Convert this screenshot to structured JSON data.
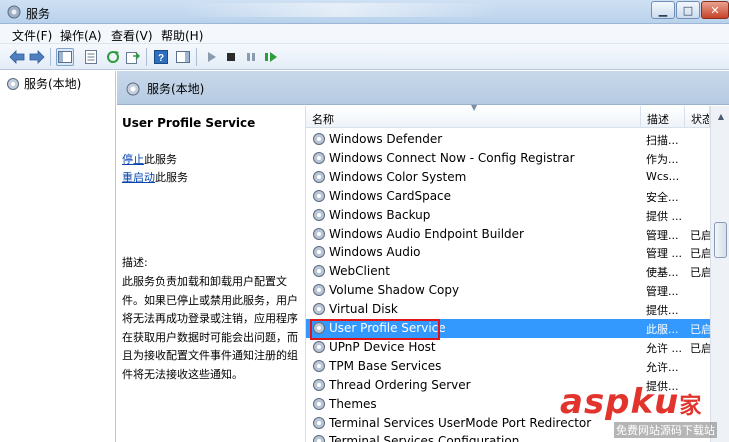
{
  "window": {
    "title": "服务"
  },
  "menu": [
    {
      "label": "文件(F)"
    },
    {
      "label": "操作(A)"
    },
    {
      "label": "查看(V)"
    },
    {
      "label": "帮助(H)"
    }
  ],
  "tree": {
    "root_label": "服务(本地)"
  },
  "header": {
    "title": "服务(本地)"
  },
  "details": {
    "service_name": "User Profile Service",
    "stop_link": "停止",
    "stop_suffix": "此服务",
    "restart_link": "重启动",
    "restart_suffix": "此服务",
    "description_label": "描述:",
    "description_text": "此服务负责加载和卸载用户配置文件。如果已停止或禁用此服务，用户将无法再成功登录或注销，应用程序在获取用户数据时可能会出问题，而且为接收配置文件事件通知注册的组件将无法接收这些通知。"
  },
  "columns": {
    "name": "名称",
    "description": "描述",
    "status": "状态"
  },
  "rows": [
    {
      "name": "Windows Defender",
      "desc": "扫描...",
      "status": ""
    },
    {
      "name": "Windows Connect Now - Config Registrar",
      "desc": "作为...",
      "status": ""
    },
    {
      "name": "Windows Color System",
      "desc": "Wcs...",
      "status": ""
    },
    {
      "name": "Windows CardSpace",
      "desc": "安全...",
      "status": ""
    },
    {
      "name": "Windows Backup",
      "desc": "提供 ...",
      "status": ""
    },
    {
      "name": "Windows Audio Endpoint Builder",
      "desc": "管理...",
      "status": "已启"
    },
    {
      "name": "Windows Audio",
      "desc": "管理 ...",
      "status": "已启"
    },
    {
      "name": "WebClient",
      "desc": "使基...",
      "status": "已启"
    },
    {
      "name": "Volume Shadow Copy",
      "desc": "管理...",
      "status": ""
    },
    {
      "name": "Virtual Disk",
      "desc": "提供...",
      "status": ""
    },
    {
      "name": "User Profile Service",
      "desc": "此服...",
      "status": "已启",
      "selected": true
    },
    {
      "name": "UPnP Device Host",
      "desc": "允许 ...",
      "status": "已启"
    },
    {
      "name": "TPM Base Services",
      "desc": "允许...",
      "status": ""
    },
    {
      "name": "Thread Ordering Server",
      "desc": "提供...",
      "status": ""
    },
    {
      "name": "Themes",
      "desc": "",
      "status": ""
    },
    {
      "name": "Terminal Services UserMode Port Redirector",
      "desc": "",
      "status": ""
    },
    {
      "name": "Terminal Services Configuration",
      "desc": "",
      "status": ""
    }
  ],
  "watermark": {
    "brand": "asp",
    "brand_ku": "ku",
    "brand_cn": "家",
    "tagline": "免费网站源码下载站"
  },
  "colors": {
    "selection": "#3399ff",
    "highlight_border": "#e0141a",
    "watermark": "#e2342d"
  }
}
